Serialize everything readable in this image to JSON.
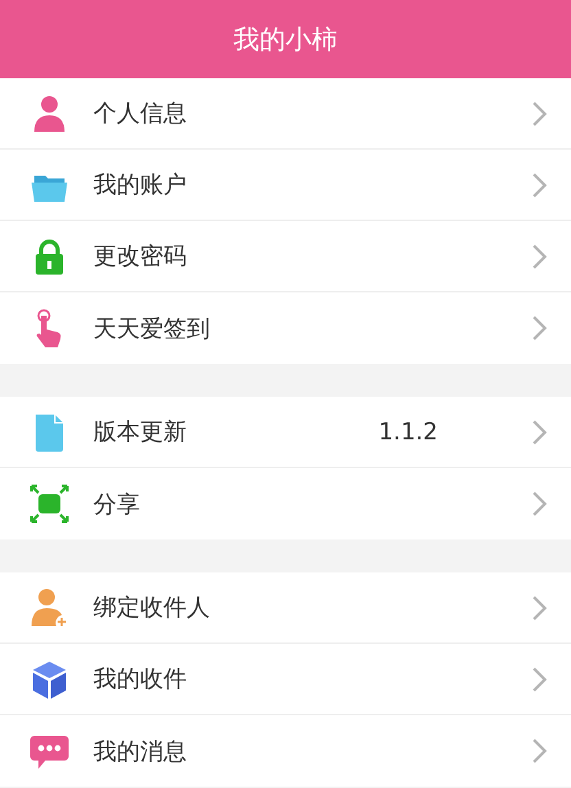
{
  "header": {
    "title": "我的小柿"
  },
  "sections": [
    {
      "items": [
        {
          "label": "个人信息"
        },
        {
          "label": "我的账户"
        },
        {
          "label": "更改密码"
        },
        {
          "label": "天天爱签到"
        }
      ]
    },
    {
      "items": [
        {
          "label": "版本更新",
          "value": "1.1.2"
        },
        {
          "label": "分享"
        }
      ]
    },
    {
      "items": [
        {
          "label": "绑定收件人"
        },
        {
          "label": "我的收件"
        },
        {
          "label": "我的消息"
        }
      ]
    }
  ]
}
